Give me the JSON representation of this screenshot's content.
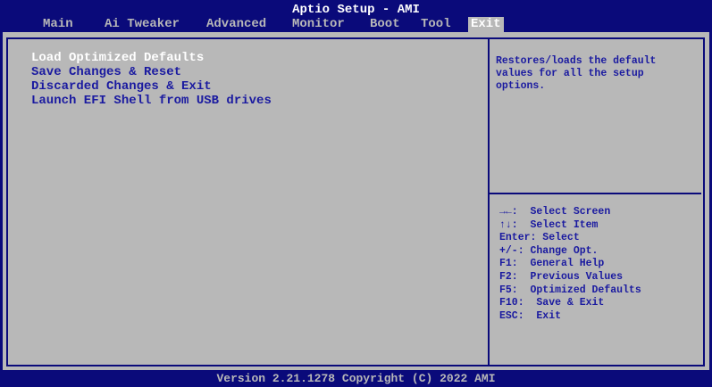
{
  "title": "Aptio Setup - AMI",
  "tabs": [
    {
      "label": "Main"
    },
    {
      "label": "Ai Tweaker"
    },
    {
      "label": "Advanced"
    },
    {
      "label": "Monitor"
    },
    {
      "label": "Boot"
    },
    {
      "label": "Tool"
    },
    {
      "label": "Exit"
    }
  ],
  "active_tab": "Exit",
  "menu": {
    "items": [
      {
        "label": "Load Optimized Defaults"
      },
      {
        "label": "Save Changes & Reset"
      },
      {
        "label": "Discarded Changes & Exit"
      },
      {
        "label": "Launch EFI Shell from USB drives"
      }
    ],
    "selected_item": "Load Optimized Defaults"
  },
  "help_text": "Restores/loads the default values for all the setup options.",
  "key_help": [
    "→←:  Select Screen",
    "↑↓:  Select Item",
    "Enter: Select",
    "+/-: Change Opt.",
    "F1:  General Help",
    "F2:  Previous Values",
    "F5:  Optimized Defaults",
    "F10:  Save & Exit",
    "ESC:  Exit"
  ],
  "footer": "Version 2.21.1278 Copyright (C) 2022 AMI",
  "colors": {
    "background": "#0a0a7a",
    "panel": "#b8b8b8",
    "text_blue": "#1a1aa0",
    "highlight": "#ffffff"
  }
}
